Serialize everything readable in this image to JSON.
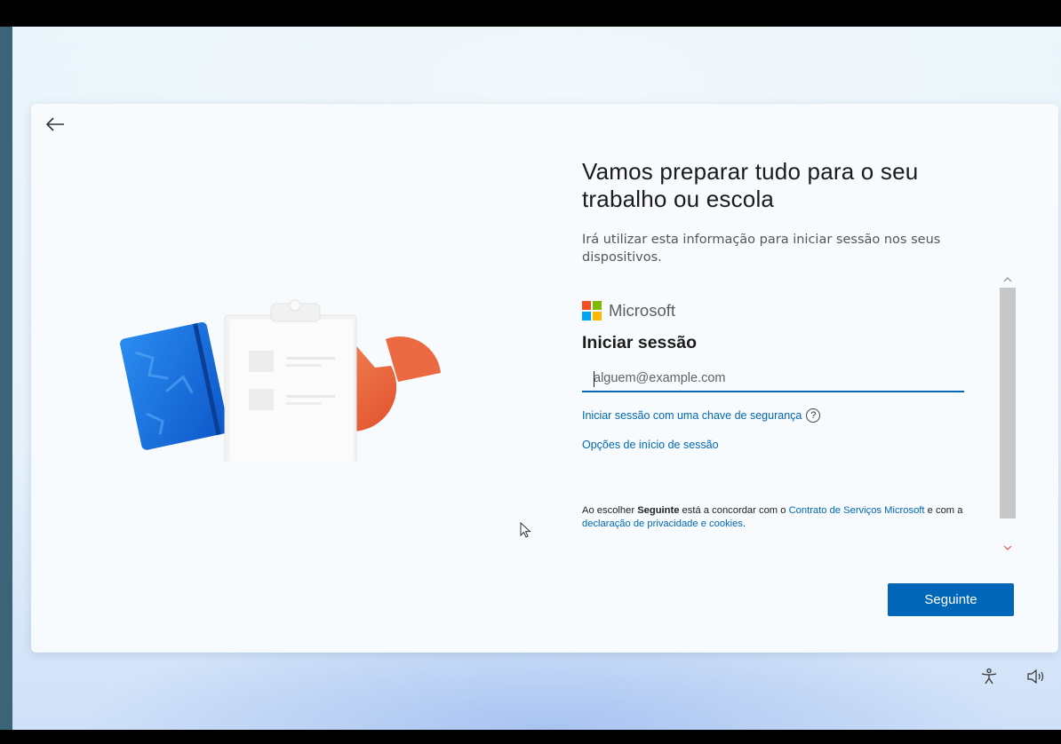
{
  "page": {
    "title": "Vamos preparar tudo para o seu trabalho ou escola",
    "subtitle": "Irá utilizar esta informação para iniciar sessão nos seus dispositivos."
  },
  "brand": {
    "name": "Microsoft",
    "colors": [
      "#f25022",
      "#7fba00",
      "#00a4ef",
      "#ffb900"
    ]
  },
  "signin": {
    "heading": "Iniciar sessão",
    "email_placeholder": "alguem@example.com",
    "email_value": "",
    "security_key_link": "Iniciar sessão com uma chave de segurança",
    "help_icon": "?",
    "options_link": "Opções de início de sessão"
  },
  "terms": {
    "prefix": "Ao escolher ",
    "bold": "Seguinte",
    "middle": " está a concordar com o ",
    "services_link": "Contrato de Serviços Microsoft",
    "and": " e com a ",
    "privacy_link": "declaração de privacidade e cookies",
    "suffix": "."
  },
  "buttons": {
    "next": "Seguinte"
  },
  "icons": {
    "back": "back-arrow-icon",
    "accessibility": "accessibility-icon",
    "volume": "volume-icon",
    "scroll_up": "chevron-up-icon",
    "scroll_down": "chevron-down-icon"
  },
  "colors": {
    "accent": "#0067b8",
    "scroll_down_arrow": "#e25555"
  }
}
